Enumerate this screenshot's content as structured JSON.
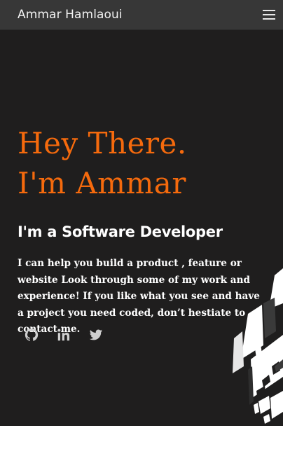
{
  "navbar": {
    "brand": "Ammar Hamlaoui",
    "menu_icon": "hamburger-menu-icon"
  },
  "hero": {
    "headline_line1": "Hey There.",
    "headline_line2": "I'm Ammar",
    "subheading": "I'm a Software Developer",
    "intro": "I can help you build a product , feature or website Look through some of my work and experience! If you like what you see and have a project you need coded, don’t hestiate to contact me.",
    "accent_color": "#f56a0d",
    "social_links": [
      {
        "icon": "github-icon"
      },
      {
        "icon": "linkedin-icon"
      },
      {
        "icon": "twitter-icon"
      }
    ]
  }
}
